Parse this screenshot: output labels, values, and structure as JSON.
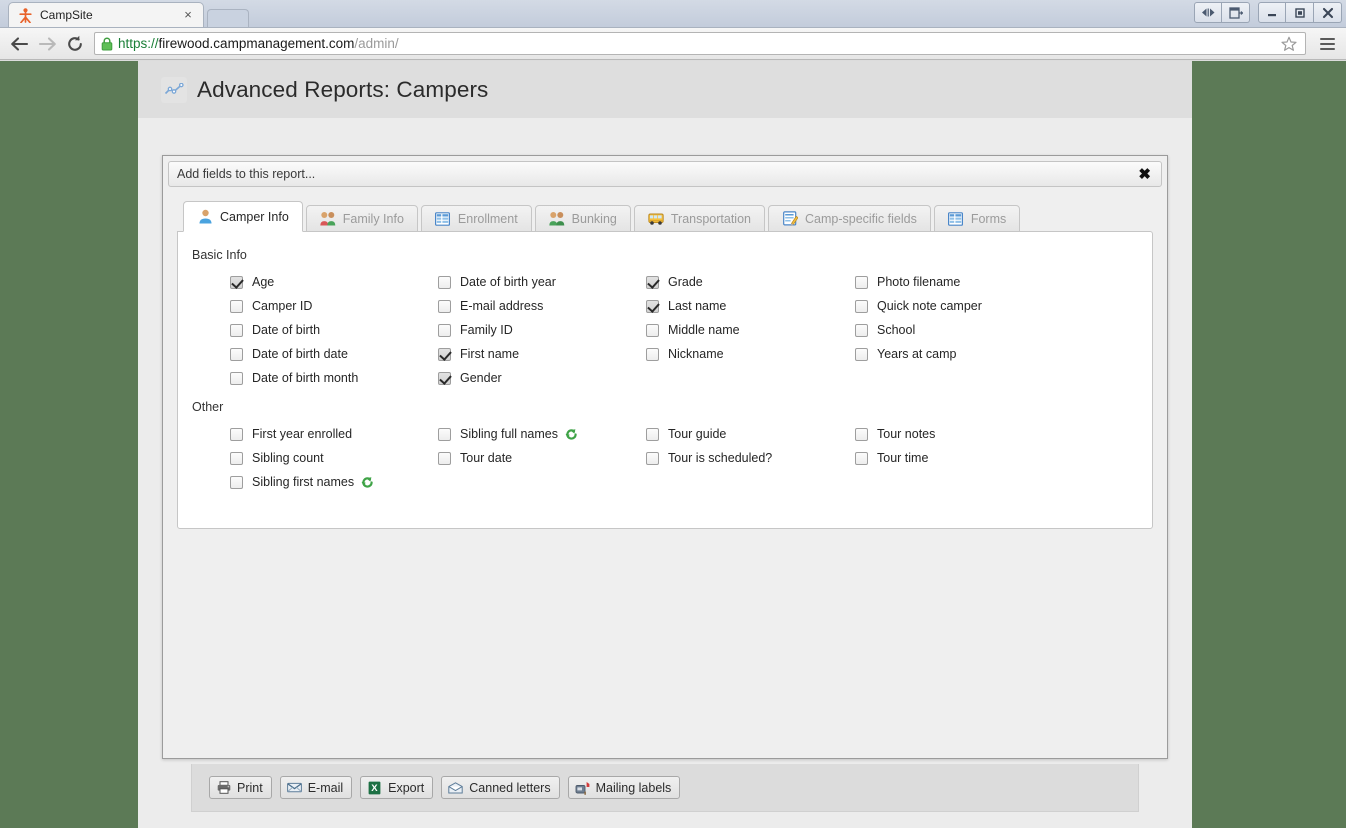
{
  "browser": {
    "tab": {
      "title": "CampSite",
      "favicon": "campsite-figure-icon",
      "close_label": "×"
    },
    "nav": {
      "back": "back-arrow-icon",
      "forward": "forward-arrow-icon",
      "reload": "reload-icon",
      "menu": "hamburger-menu-icon",
      "bookmark": "star-icon"
    },
    "url": {
      "scheme": "https://",
      "host": "firewood.campmanagement.com",
      "path": "/admin/",
      "lock": "lock-icon"
    },
    "window_controls": [
      {
        "name": "split-view-button",
        "glyph": "◀▶"
      },
      {
        "name": "restore-pane-button",
        "glyph": "❐"
      },
      {
        "name": "minimize-button",
        "glyph": "—"
      },
      {
        "name": "maximize-button",
        "glyph": "❐"
      },
      {
        "name": "close-button",
        "glyph": "✕"
      }
    ]
  },
  "page": {
    "title": "Advanced Reports: Campers",
    "title_icon": "line-chart-icon"
  },
  "dialog": {
    "title": "Add fields to this report...",
    "close_label": "✖"
  },
  "tabs": [
    {
      "label": "Camper Info",
      "icon": "person-icon",
      "active": true
    },
    {
      "label": "Family Info",
      "icon": "family-icon",
      "active": false
    },
    {
      "label": "Enrollment",
      "icon": "table-icon",
      "active": false
    },
    {
      "label": "Bunking",
      "icon": "two-people-icon",
      "active": false
    },
    {
      "label": "Transportation",
      "icon": "school-bus-icon",
      "active": false
    },
    {
      "label": "Camp-specific fields",
      "icon": "memo-pencil-icon",
      "active": false
    },
    {
      "label": "Forms",
      "icon": "table-icon",
      "active": false
    }
  ],
  "sections": [
    {
      "label": "Basic Info",
      "fields": [
        {
          "label": "Age",
          "checked": true,
          "badge": null
        },
        {
          "label": "Date of birth year",
          "checked": false,
          "badge": null
        },
        {
          "label": "Grade",
          "checked": true,
          "badge": null
        },
        {
          "label": "Photo filename",
          "checked": false,
          "badge": null
        },
        {
          "label": "Camper ID",
          "checked": false,
          "badge": null
        },
        {
          "label": "E-mail address",
          "checked": false,
          "badge": null
        },
        {
          "label": "Last name",
          "checked": true,
          "badge": null
        },
        {
          "label": "Quick note camper",
          "checked": false,
          "badge": null
        },
        {
          "label": "Date of birth",
          "checked": false,
          "badge": null
        },
        {
          "label": "Family ID",
          "checked": false,
          "badge": null
        },
        {
          "label": "Middle name",
          "checked": false,
          "badge": null
        },
        {
          "label": "School",
          "checked": false,
          "badge": null
        },
        {
          "label": "Date of birth date",
          "checked": false,
          "badge": null
        },
        {
          "label": "First name",
          "checked": true,
          "badge": null
        },
        {
          "label": "Nickname",
          "checked": false,
          "badge": null
        },
        {
          "label": "Years at camp",
          "checked": false,
          "badge": null
        },
        {
          "label": "Date of birth month",
          "checked": false,
          "badge": null
        },
        {
          "label": "Gender",
          "checked": true,
          "badge": null
        },
        {
          "label": "",
          "checked": false,
          "badge": null
        },
        {
          "label": "",
          "checked": false,
          "badge": null
        }
      ]
    },
    {
      "label": "Other",
      "fields": [
        {
          "label": "First year enrolled",
          "checked": false,
          "badge": null
        },
        {
          "label": "Sibling full names",
          "checked": false,
          "badge": "green-refresh-icon"
        },
        {
          "label": "Tour guide",
          "checked": false,
          "badge": null
        },
        {
          "label": "Tour notes",
          "checked": false,
          "badge": null
        },
        {
          "label": "Sibling count",
          "checked": false,
          "badge": null
        },
        {
          "label": "Tour date",
          "checked": false,
          "badge": null
        },
        {
          "label": "Tour is scheduled?",
          "checked": false,
          "badge": null
        },
        {
          "label": "Tour time",
          "checked": false,
          "badge": null
        },
        {
          "label": "Sibling first names",
          "checked": false,
          "badge": "green-refresh-icon"
        },
        {
          "label": "",
          "checked": false,
          "badge": null
        },
        {
          "label": "",
          "checked": false,
          "badge": null
        },
        {
          "label": "",
          "checked": false,
          "badge": null
        }
      ]
    }
  ],
  "toolbar": [
    {
      "label": "Print",
      "icon": "printer-icon"
    },
    {
      "label": "E-mail",
      "icon": "envelope-icon"
    },
    {
      "label": "Export",
      "icon": "excel-icon"
    },
    {
      "label": "Canned letters",
      "icon": "open-envelope-icon"
    },
    {
      "label": "Mailing labels",
      "icon": "mailbox-icon"
    }
  ],
  "colors": {
    "page_background": "#5c7a56",
    "panel": "#ececec",
    "accent_green": "#4caf50"
  }
}
